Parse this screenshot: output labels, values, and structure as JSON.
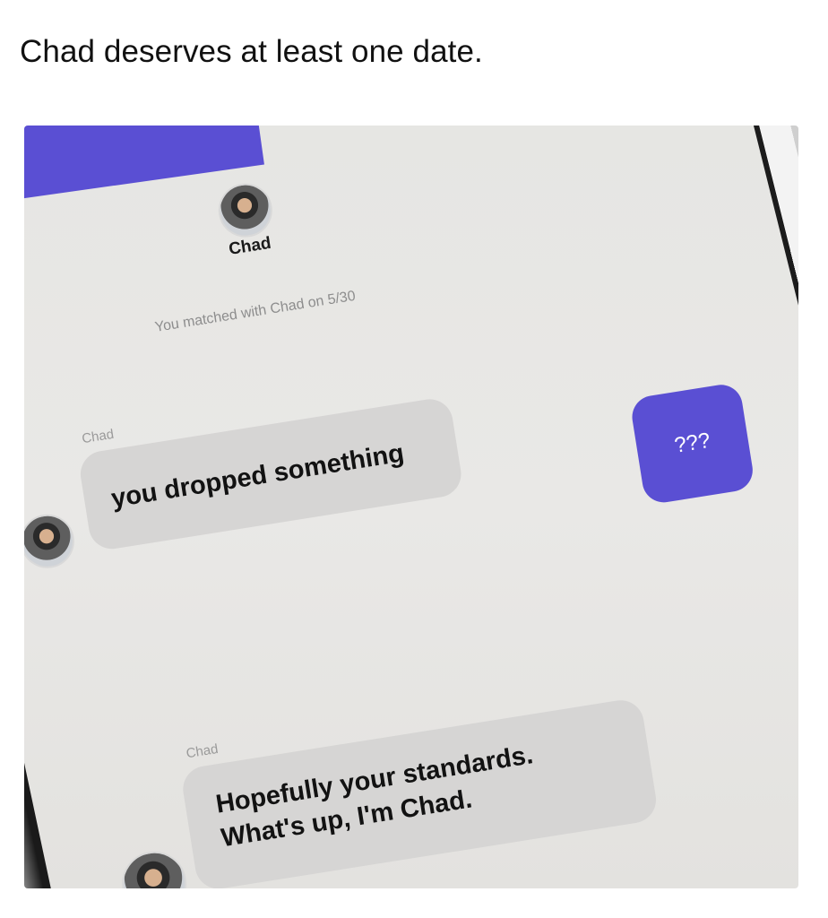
{
  "caption": "Chad deserves at least one date.",
  "chat": {
    "contact_name": "Chad",
    "match_note": "You matched with Chad on 5/30",
    "messages": [
      {
        "sender": "Chad",
        "from_me": false,
        "text": "you dropped something"
      },
      {
        "sender": "me",
        "from_me": true,
        "text": "???"
      },
      {
        "sender": "Chad",
        "from_me": false,
        "line1": "Hopefully your standards.",
        "line2": "What's up, I'm Chad."
      }
    ]
  },
  "colors": {
    "accent": "#5a4fd3",
    "incoming_bubble": "#d6d5d4",
    "screen_bg": "#e7e6e4"
  },
  "icons": [
    "avatar-photo"
  ]
}
